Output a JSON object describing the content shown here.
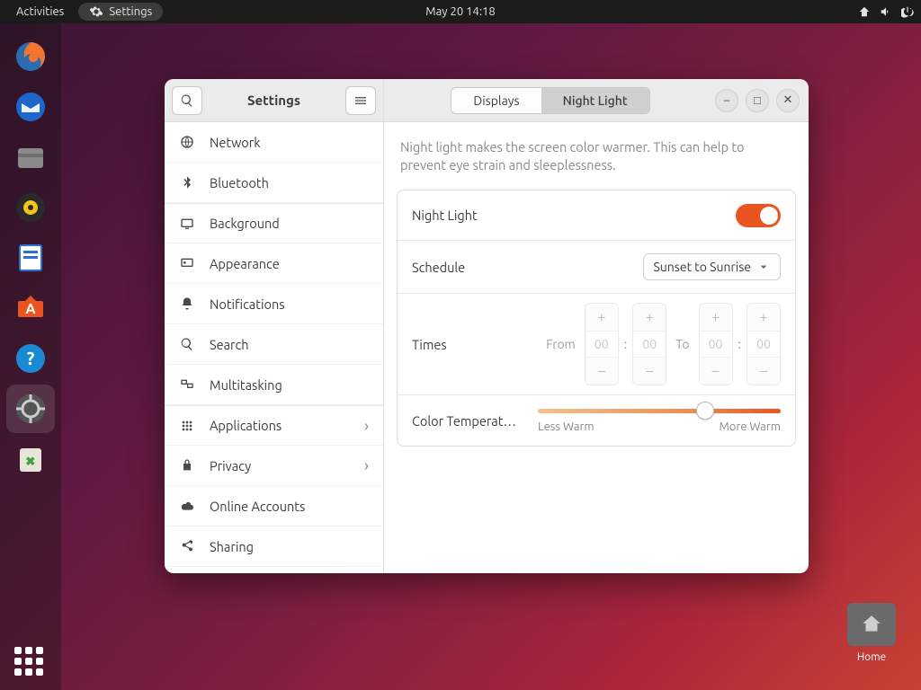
{
  "topbar": {
    "activities": "Activities",
    "app_menu": "Settings",
    "clock": "May 20  14:18"
  },
  "dock": {
    "items": [
      "firefox",
      "thunderbird",
      "files",
      "rhythmbox",
      "libreoffice",
      "software",
      "help",
      "settings",
      "trash"
    ]
  },
  "desktop": {
    "home_label": "Home"
  },
  "window": {
    "title": "Settings",
    "sidebar": [
      {
        "key": "network",
        "label": "Network"
      },
      {
        "key": "bluetooth",
        "label": "Bluetooth"
      },
      {
        "key": "background",
        "label": "Background",
        "sep": true
      },
      {
        "key": "appearance",
        "label": "Appearance"
      },
      {
        "key": "notifications",
        "label": "Notifications"
      },
      {
        "key": "search",
        "label": "Search"
      },
      {
        "key": "multitasking",
        "label": "Multitasking"
      },
      {
        "key": "applications",
        "label": "Applications",
        "chevron": true,
        "sep": true
      },
      {
        "key": "privacy",
        "label": "Privacy",
        "chevron": true
      },
      {
        "key": "online-accounts",
        "label": "Online Accounts"
      },
      {
        "key": "sharing",
        "label": "Sharing"
      }
    ],
    "tabs": {
      "displays": "Displays",
      "night_light": "Night Light"
    },
    "night_light": {
      "description": "Night light makes the screen color warmer. This can help to prevent eye strain and sleeplessness.",
      "toggle_label": "Night Light",
      "schedule_label": "Schedule",
      "schedule_value": "Sunset to Sunrise",
      "times_label": "Times",
      "from_label": "From",
      "to_label": "To",
      "from_h": "00",
      "from_m": "00",
      "to_h": "00",
      "to_m": "00",
      "color_temp_label": "Color Temperature",
      "less_warm": "Less Warm",
      "more_warm": "More Warm"
    }
  }
}
